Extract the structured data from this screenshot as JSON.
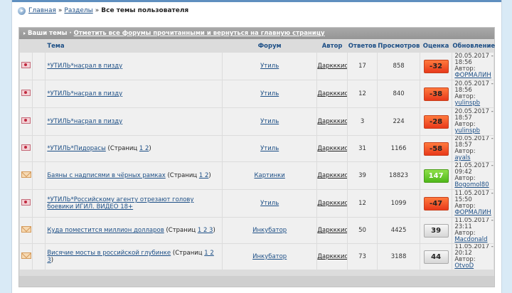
{
  "breadcrumb": {
    "home": "Главная",
    "sections": "Разделы",
    "current": "Все темы пользователя"
  },
  "box": {
    "title": "Ваши темы",
    "separator": "·",
    "mark_read_link": "Отметить все форумы прочитанными и вернуться на главную страницу"
  },
  "columns": {
    "topic": "Тема",
    "forum": "Форум",
    "author": "Автор",
    "replies": "Ответов",
    "views": "Просмотров",
    "rating": "Оценка",
    "updated": "Обновление"
  },
  "pages_label": "Страниц",
  "rows": [
    {
      "icon": "locked-topic-icon",
      "title": "*УТИЛЬ*насрал в пизду",
      "pages": "",
      "forum": "Утиль",
      "author": "Даркккис",
      "replies": "17",
      "views": "858",
      "rating": "-32",
      "rating_kind": "neg",
      "updated_date": "20.05.2017 -",
      "updated_time": "18:56",
      "updated_by_label": "Автор:",
      "updated_by": "ФОРМАЛИН"
    },
    {
      "icon": "locked-topic-icon",
      "title": "*УТИЛЬ*насрал в пизду",
      "pages": "",
      "forum": "Утиль",
      "author": "Даркккис",
      "replies": "12",
      "views": "840",
      "rating": "-38",
      "rating_kind": "neg",
      "updated_date": "20.05.2017 -",
      "updated_time": "18:56",
      "updated_by_label": "Автор:",
      "updated_by": "yulinspb"
    },
    {
      "icon": "locked-topic-icon",
      "title": "*УТИЛЬ*насрал в пизду",
      "pages": "",
      "forum": "Утиль",
      "author": "Даркккис",
      "replies": "3",
      "views": "224",
      "rating": "-28",
      "rating_kind": "neg",
      "updated_date": "20.05.2017 -",
      "updated_time": "18:57",
      "updated_by_label": "Автор:",
      "updated_by": "yulinspb"
    },
    {
      "icon": "locked-topic-icon",
      "title": "*УТИЛЬ*Пидорасы",
      "pages": "1 2",
      "forum": "Утиль",
      "author": "Даркккис",
      "replies": "31",
      "views": "1166",
      "rating": "-58",
      "rating_kind": "neg",
      "updated_date": "20.05.2017 -",
      "updated_time": "18:57",
      "updated_by_label": "Автор:",
      "updated_by": "ayals"
    },
    {
      "icon": "topic-mail-icon",
      "title": "Баяны с надписями в чёрных рамках",
      "pages": "1 2",
      "forum": "Картинки",
      "author": "Даркккис",
      "replies": "39",
      "views": "18823",
      "rating": "147",
      "rating_kind": "pos",
      "updated_date": "21.05.2017 -",
      "updated_time": "09:42",
      "updated_by_label": "Автор:",
      "updated_by": "Bogomol80"
    },
    {
      "icon": "locked-topic-icon",
      "title": "*УТИЛЬ*Российскому агенту отрезают голову боевики ИГИЛ. ВИДЕО 18+",
      "pages": "",
      "forum": "Утиль",
      "author": "Даркккис",
      "replies": "12",
      "views": "1099",
      "rating": "-47",
      "rating_kind": "neg",
      "updated_date": "11.05.2017 -",
      "updated_time": "15:50",
      "updated_by_label": "Автор:",
      "updated_by": "ФОРМАЛИН"
    },
    {
      "icon": "topic-mail-icon",
      "title": "Куда поместится миллион долларов",
      "pages": "1 2 3",
      "forum": "Инкубатор",
      "author": "Даркккис",
      "replies": "50",
      "views": "4425",
      "rating": "39",
      "rating_kind": "neu",
      "updated_date": "11.05.2017 -",
      "updated_time": "23:11",
      "updated_by_label": "Автор:",
      "updated_by": "Macdonald"
    },
    {
      "icon": "topic-mail-icon",
      "title": "Висячие мосты в российской глубинке",
      "pages": "1 2 3",
      "forum": "Инкубатор",
      "author": "Даркккис",
      "replies": "73",
      "views": "3188",
      "rating": "44",
      "rating_kind": "neu",
      "updated_date": "11.05.2017 -",
      "updated_time": "20:12",
      "updated_by_label": "Автор:",
      "updated_by": "OtvoD"
    }
  ]
}
